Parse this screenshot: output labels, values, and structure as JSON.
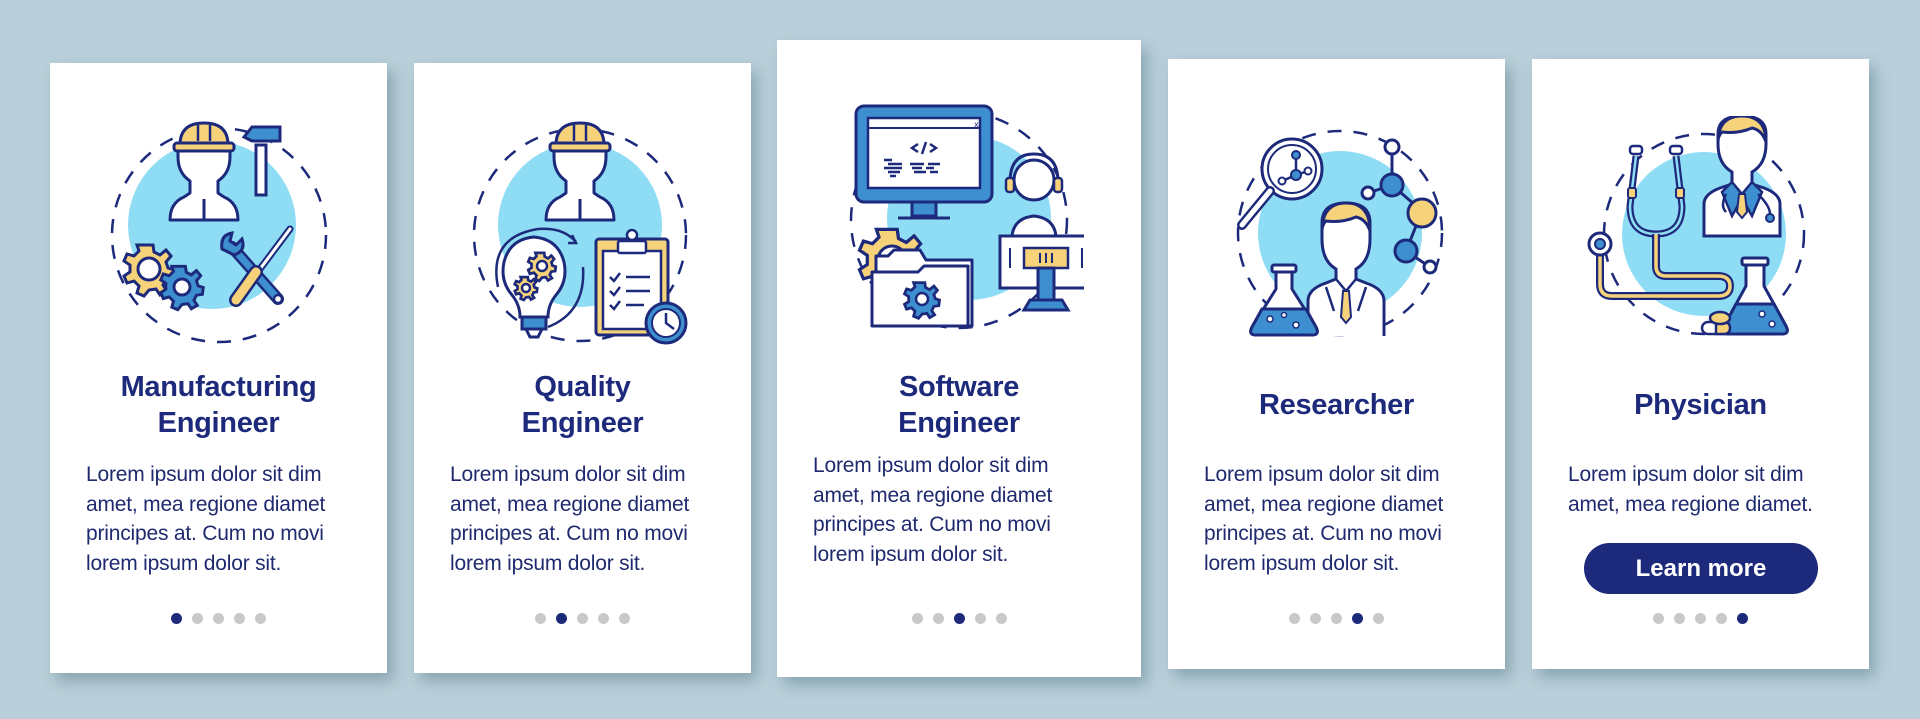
{
  "colors": {
    "background": "#b9d0da",
    "card": "#ffffff",
    "navy": "#1d2a7b",
    "light_blue": "#8fdcf5",
    "mid_blue": "#3e8fd0",
    "yellow": "#f6d27a",
    "dot_inactive": "#c9c9c9"
  },
  "cards": [
    {
      "icon": "manufacturing-engineer-illustration",
      "title_lines": [
        "Manufacturing",
        "Engineer"
      ],
      "body_lines": [
        "Lorem ipsum dolor sit dim",
        "amet, mea regione diamet",
        "principes at. Cum no movi",
        "lorem ipsum dolor sit."
      ],
      "page_index": 1,
      "page_count": 5
    },
    {
      "icon": "quality-engineer-illustration",
      "title_lines": [
        "Quality",
        "Engineer"
      ],
      "body_lines": [
        "Lorem ipsum dolor sit dim",
        "amet, mea regione diamet",
        "principes at. Cum no movi",
        "lorem ipsum dolor sit."
      ],
      "page_index": 2,
      "page_count": 5
    },
    {
      "icon": "software-engineer-illustration",
      "title_lines": [
        "Software",
        "Engineer"
      ],
      "body_lines": [
        "Lorem ipsum dolor sit dim",
        "amet, mea regione diamet",
        "principes at. Cum no movi",
        "lorem ipsum dolor sit."
      ],
      "page_index": 3,
      "page_count": 5
    },
    {
      "icon": "researcher-illustration",
      "title_lines": [
        "Researcher"
      ],
      "body_lines": [
        "Lorem ipsum dolor sit dim",
        "amet, mea regione diamet",
        "principes at. Cum no movi",
        "lorem ipsum dolor sit."
      ],
      "page_index": 4,
      "page_count": 5
    },
    {
      "icon": "physician-illustration",
      "title_lines": [
        "Physician"
      ],
      "body_lines": [
        "Lorem ipsum dolor sit dim",
        "amet, mea regione diamet."
      ],
      "button_label": "Learn more",
      "page_index": 5,
      "page_count": 5
    }
  ]
}
